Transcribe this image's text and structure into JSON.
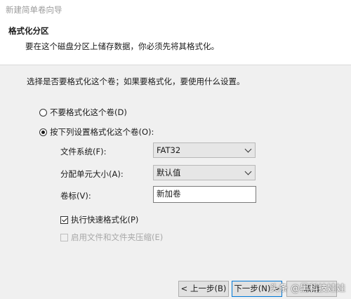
{
  "window": {
    "title": "新建简单卷向导"
  },
  "header": {
    "title": "格式化分区",
    "subtitle": "要在这个磁盘分区上储存数据，你必须先将其格式化。"
  },
  "main": {
    "prompt": "选择是否要格式化这个卷；如果要格式化，要使用什么设置。",
    "radio_no_format": {
      "label": "不要格式化这个卷(D)",
      "selected": false
    },
    "radio_format": {
      "label": "按下列设置格式化这个卷(O):",
      "selected": true
    },
    "file_system": {
      "label": "文件系统(F):",
      "value": "FAT32"
    },
    "allocation_unit": {
      "label": "分配单元大小(A):",
      "value": "默认值"
    },
    "volume_label": {
      "label": "卷标(V):",
      "value": "新加卷"
    },
    "quick_format": {
      "label": "执行快速格式化(P)",
      "checked": true
    },
    "compression": {
      "label": "启用文件和文件夹压缩(E)",
      "checked": false,
      "enabled": false
    }
  },
  "footer": {
    "back_label": "< 上一步(B)",
    "next_label": "下一步(N) >",
    "third_label": "取消"
  },
  "watermark": {
    "text": "头条 @黑科技娃娃"
  }
}
